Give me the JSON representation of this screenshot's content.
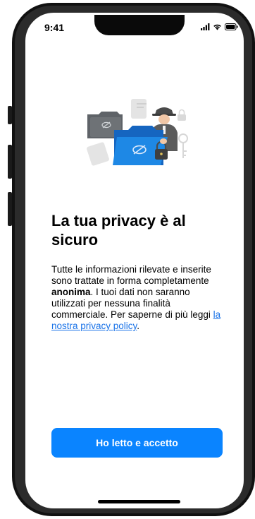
{
  "status_bar": {
    "time": "9:41",
    "icons": [
      "signal-icon",
      "wifi-icon",
      "battery-icon"
    ]
  },
  "illustration": {
    "name": "spy-with-folders-illustration",
    "colors": {
      "folder_blue": "#1E88E5",
      "folder_dark": "#5f6368",
      "gray": "#c8c8c8"
    }
  },
  "heading": {
    "title": "La tua privacy è al sicuro"
  },
  "description": {
    "before_bold": "Tutte le informazioni rilevate e inserite sono trattate in forma completamente ",
    "bold": "anonima",
    "after_bold": ". I tuoi dati non saranno utilizzati per nessuna finalità commerciale. Per saperne di più leggi ",
    "link": "la nostra privacy policy",
    "end": "."
  },
  "actions": {
    "accept_label": "Ho letto e accetto"
  },
  "colors": {
    "accent": "#0A84FF",
    "link": "#1A73E8",
    "text": "#000000",
    "background": "#FFFFFF"
  }
}
